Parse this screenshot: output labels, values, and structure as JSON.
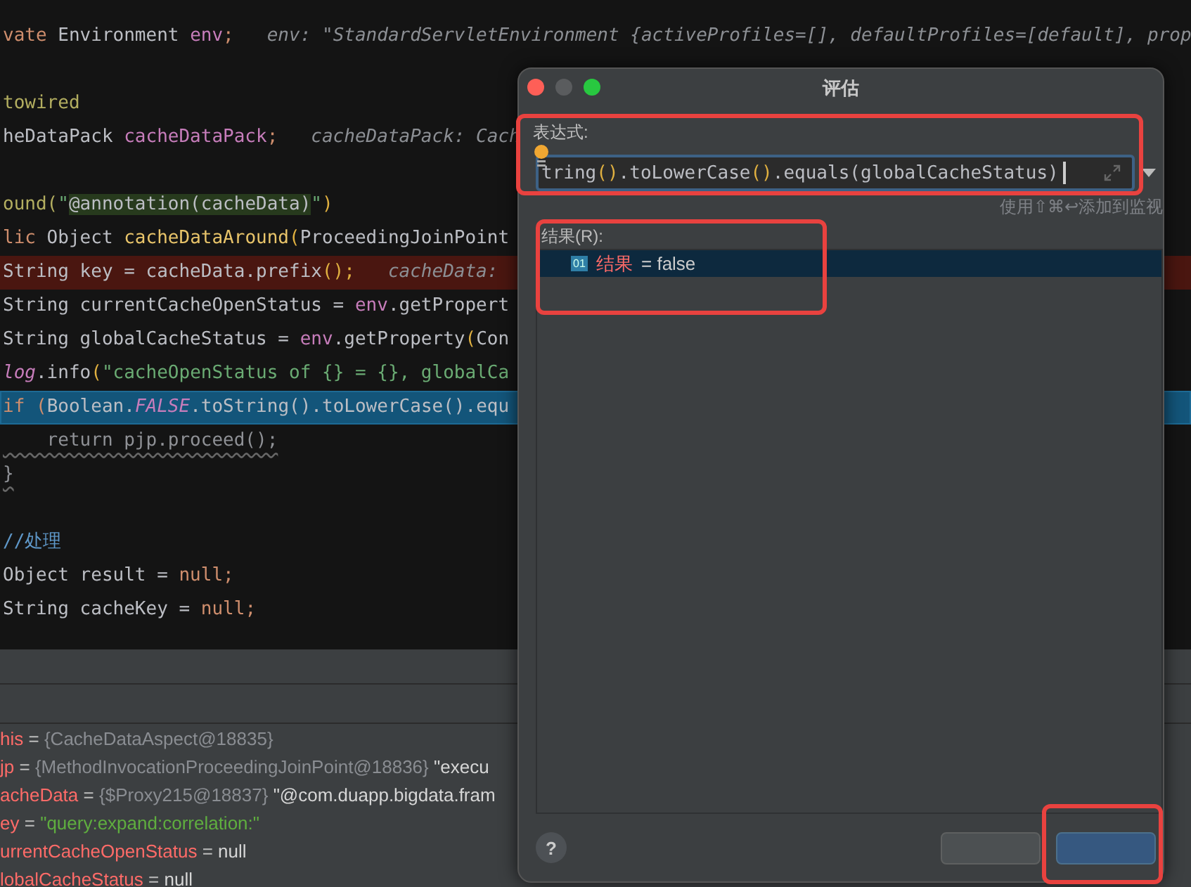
{
  "editor": {
    "lines": [
      {
        "kind": "blank"
      },
      {
        "kind": "code",
        "breakpoint": false,
        "execution_point": false,
        "tokens": [
          {
            "text": "vate",
            "kind": "keyword"
          },
          {
            "text": " Environment ",
            "kind": "plain"
          },
          {
            "text": "env",
            "kind": "field"
          },
          {
            "text": ";",
            "kind": "keyword"
          },
          {
            "text": "   env: \"StandardServletEnvironment {activeProfiles=[], defaultProfiles=[default], prop",
            "kind": "hint"
          }
        ]
      },
      {
        "kind": "blank"
      },
      {
        "kind": "code",
        "breakpoint": false,
        "execution_point": false,
        "tokens": [
          {
            "text": "towired",
            "kind": "annotation"
          }
        ]
      },
      {
        "kind": "code",
        "breakpoint": false,
        "execution_point": false,
        "tokens": [
          {
            "text": "heDataPack ",
            "kind": "plain"
          },
          {
            "text": "cacheDataPack",
            "kind": "field"
          },
          {
            "text": ";",
            "kind": "keyword"
          },
          {
            "text": "   cacheDataPack: Cach",
            "kind": "hint"
          }
        ]
      },
      {
        "kind": "blank"
      },
      {
        "kind": "code",
        "breakpoint": false,
        "execution_point": false,
        "tokens": [
          {
            "text": "ound(",
            "kind": "annotation"
          },
          {
            "text": "\"",
            "kind": "string"
          },
          {
            "text": "@annotation(cacheData)",
            "kind": "match"
          },
          {
            "text": "\"",
            "kind": "string"
          },
          {
            "text": ")",
            "kind": "paren"
          }
        ]
      },
      {
        "kind": "code",
        "breakpoint": false,
        "execution_point": false,
        "tokens": [
          {
            "text": "lic",
            "kind": "keyword"
          },
          {
            "text": " Object ",
            "kind": "plain"
          },
          {
            "text": "cacheDataAround",
            "kind": "func"
          },
          {
            "text": "(",
            "kind": "paren"
          },
          {
            "text": "ProceedingJoinPoint",
            "kind": "plain"
          }
        ]
      },
      {
        "kind": "code",
        "breakpoint": true,
        "execution_point": false,
        "tokens": [
          {
            "text": "String key = cacheData.prefix",
            "kind": "plain"
          },
          {
            "text": "();",
            "kind": "paren"
          },
          {
            "text": "   cacheData:",
            "kind": "hint"
          }
        ]
      },
      {
        "kind": "code",
        "breakpoint": false,
        "execution_point": false,
        "tokens": [
          {
            "text": "String currentCacheOpenStatus = ",
            "kind": "plain"
          },
          {
            "text": "env",
            "kind": "field"
          },
          {
            "text": ".getPropert",
            "kind": "plain"
          }
        ]
      },
      {
        "kind": "code",
        "breakpoint": false,
        "execution_point": false,
        "tokens": [
          {
            "text": "String globalCacheStatus = ",
            "kind": "plain"
          },
          {
            "text": "env",
            "kind": "field"
          },
          {
            "text": ".getProperty",
            "kind": "plain"
          },
          {
            "text": "(",
            "kind": "paren"
          },
          {
            "text": "Con",
            "kind": "plain"
          }
        ]
      },
      {
        "kind": "code",
        "breakpoint": false,
        "execution_point": false,
        "tokens": [
          {
            "text": "log",
            "kind": "static"
          },
          {
            "text": ".info",
            "kind": "plain"
          },
          {
            "text": "(",
            "kind": "paren"
          },
          {
            "text": "\"cacheOpenStatus of {} = {}, globalCa",
            "kind": "string"
          }
        ]
      },
      {
        "kind": "code",
        "breakpoint": false,
        "execution_point": true,
        "tokens": [
          {
            "text": "if (",
            "kind": "keyword"
          },
          {
            "text": "Boolean.",
            "kind": "plain"
          },
          {
            "text": "FALSE",
            "kind": "static"
          },
          {
            "text": ".toString().toLowerCase().equ",
            "kind": "plain"
          }
        ]
      },
      {
        "kind": "code",
        "breakpoint": false,
        "execution_point": false,
        "tokens": [
          {
            "text": "    return pjp.proceed();",
            "kind": "dim"
          }
        ]
      },
      {
        "kind": "code",
        "breakpoint": false,
        "execution_point": false,
        "tokens": [
          {
            "text": "}",
            "kind": "dim"
          }
        ]
      },
      {
        "kind": "blank"
      },
      {
        "kind": "code",
        "breakpoint": false,
        "execution_point": false,
        "tokens": [
          {
            "text": "//处理",
            "kind": "comment"
          }
        ]
      },
      {
        "kind": "code",
        "breakpoint": false,
        "execution_point": false,
        "tokens": [
          {
            "text": "Object result = ",
            "kind": "plain"
          },
          {
            "text": "null;",
            "kind": "keyword"
          }
        ]
      },
      {
        "kind": "code",
        "breakpoint": false,
        "execution_point": false,
        "tokens": [
          {
            "text": "String cacheKey = ",
            "kind": "plain"
          },
          {
            "text": "null;",
            "kind": "keyword"
          }
        ]
      }
    ]
  },
  "variables": [
    {
      "name": "his",
      "parts": [
        {
          "text": "=",
          "kind": "op"
        },
        {
          "text": "{CacheDataAspect@18835}",
          "kind": "ref"
        }
      ]
    },
    {
      "name": "jp",
      "parts": [
        {
          "text": "=",
          "kind": "op"
        },
        {
          "text": "{MethodInvocationProceedingJoinPoint@18836}",
          "kind": "ref"
        },
        {
          "text": "\"execu",
          "kind": "text"
        }
      ]
    },
    {
      "name": "acheData",
      "parts": [
        {
          "text": "=",
          "kind": "op"
        },
        {
          "text": "{$Proxy215@18837}",
          "kind": "ref"
        },
        {
          "text": "\"@com.duapp.bigdata.fram",
          "kind": "text"
        }
      ]
    },
    {
      "name": "ey",
      "parts": [
        {
          "text": "=",
          "kind": "op"
        },
        {
          "text": "\"query:expand:correlation:\"",
          "kind": "string"
        }
      ]
    },
    {
      "name": "urrentCacheOpenStatus",
      "parts": [
        {
          "text": "=",
          "kind": "op"
        },
        {
          "text": "null",
          "kind": "text"
        }
      ]
    },
    {
      "name": "lobalCacheStatus",
      "parts": [
        {
          "text": "=",
          "kind": "op"
        },
        {
          "text": "null",
          "kind": "text"
        }
      ]
    }
  ],
  "dialog": {
    "title": "评估",
    "expression_label": "表达式:",
    "expression": "tring().toLowerCase().equals(globalCacheStatus)",
    "hint": "使用⇧⌘↩添加到监视",
    "result_label": "结果(R):",
    "results": [
      {
        "badge": "01",
        "name": "结果",
        "value": "= false",
        "selected": true
      }
    ],
    "help": "?",
    "buttons": [
      {
        "kind": "secondary"
      },
      {
        "kind": "primary"
      }
    ]
  },
  "annotations": [
    {
      "kind": "box"
    },
    {
      "kind": "box"
    },
    {
      "kind": "box"
    }
  ]
}
